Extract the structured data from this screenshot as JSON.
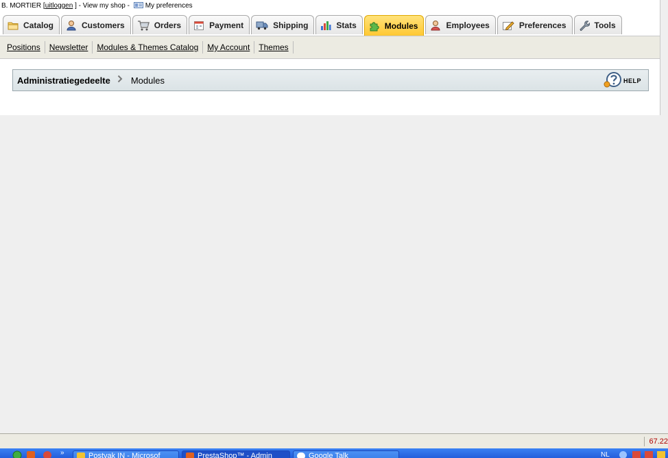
{
  "topbar": {
    "user": "B. MORTIER [",
    "logout": "uitloggen",
    "after_logout": "] -",
    "view_shop": "View my shop",
    "sep": "-",
    "preferences": "My preferences"
  },
  "tabs": [
    {
      "label": "Catalog",
      "icon": "folder-icon"
    },
    {
      "label": "Customers",
      "icon": "customer-icon"
    },
    {
      "label": "Orders",
      "icon": "cart-icon"
    },
    {
      "label": "Payment",
      "icon": "calendar-icon"
    },
    {
      "label": "Shipping",
      "icon": "truck-icon"
    },
    {
      "label": "Stats",
      "icon": "bar-chart-icon"
    },
    {
      "label": "Modules",
      "icon": "puzzle-icon",
      "active": true
    },
    {
      "label": "Employees",
      "icon": "employee-icon"
    },
    {
      "label": "Preferences",
      "icon": "pencil-icon"
    },
    {
      "label": "Tools",
      "icon": "wrench-icon"
    }
  ],
  "subnav": [
    "Positions",
    "Newsletter",
    "Modules & Themes Catalog",
    "My Account",
    "Themes"
  ],
  "breadcrumb": {
    "root": "Administratiegedeelte",
    "current": "Modules"
  },
  "help_label": "HELP",
  "statusbar": {
    "value": "67.22"
  },
  "taskbar": {
    "items": [
      {
        "label": "Postvak IN - Microsof"
      },
      {
        "label": "PrestaShop™ - Admin"
      },
      {
        "label": "Google Talk"
      }
    ],
    "tray_text": "NL"
  },
  "colors": {
    "active_tab": "#ffc832",
    "subnav_bg": "#ecebe2",
    "breadcrumb_bg": "#dbe3e6",
    "status_value": "#b00000",
    "taskbar": "#245edb"
  }
}
